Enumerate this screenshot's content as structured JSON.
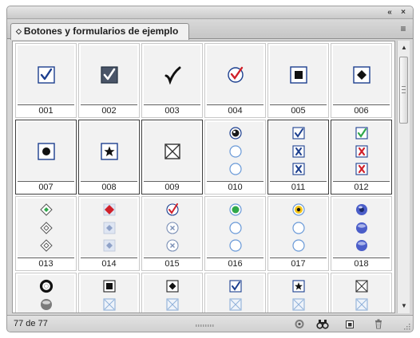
{
  "panel": {
    "collapse_label": "«",
    "close_label": "×",
    "tab_caret": "◇",
    "tab_title": "Botones y formularios de ejemplo",
    "menu_glyph": "≡"
  },
  "cells": [
    {
      "label": "001",
      "icon": "checkbox-checked-icon",
      "selected": false
    },
    {
      "label": "002",
      "icon": "checkbox-dark-checked-icon",
      "selected": false
    },
    {
      "label": "003",
      "icon": "checkmark-icon",
      "selected": false
    },
    {
      "label": "004",
      "icon": "circle-red-check-icon",
      "selected": false
    },
    {
      "label": "005",
      "icon": "square-filled-icon",
      "selected": false
    },
    {
      "label": "006",
      "icon": "diamond-in-square-icon",
      "selected": false
    },
    {
      "label": "007",
      "icon": "circle-in-square-icon",
      "selected": true
    },
    {
      "label": "008",
      "icon": "star-in-square-icon",
      "selected": true
    },
    {
      "label": "009",
      "icon": "x-box-icon",
      "selected": true
    },
    {
      "label": "010",
      "icon": "radio-set-icon",
      "selected": false
    },
    {
      "label": "011",
      "icon": "check-x-set-icon",
      "selected": true
    },
    {
      "label": "012",
      "icon": "green-check-red-x-set-icon",
      "selected": true
    },
    {
      "label": "013",
      "icon": "diamond-radio-set-icon",
      "selected": false
    },
    {
      "label": "014",
      "icon": "red-diamond-set-icon",
      "selected": false
    },
    {
      "label": "015",
      "icon": "circle-check-x-set-icon",
      "selected": false
    },
    {
      "label": "016",
      "icon": "green-radio-set-icon",
      "selected": false
    },
    {
      "label": "017",
      "icon": "yellow-radio-set-icon",
      "selected": false
    },
    {
      "label": "018",
      "icon": "blue-sphere-set-icon",
      "selected": false
    },
    {
      "label": "",
      "icon": "ring-sphere-set-icon",
      "selected": false
    },
    {
      "label": "",
      "icon": "square-stack-icon",
      "selected": false
    },
    {
      "label": "",
      "icon": "diamond-stack-icon",
      "selected": false
    },
    {
      "label": "",
      "icon": "check-stack-icon",
      "selected": false
    },
    {
      "label": "",
      "icon": "star-stack-icon",
      "selected": false
    },
    {
      "label": "",
      "icon": "xbox-stack-icon",
      "selected": false
    }
  ],
  "status": {
    "count_text": "77 de 77"
  },
  "colors": {
    "check_blue": "#1c3f8f",
    "check_red": "#d0202a",
    "check_green": "#2fa84a",
    "radio_outline": "#6a9ad8",
    "sphere_blue": "#4b5ec9"
  }
}
